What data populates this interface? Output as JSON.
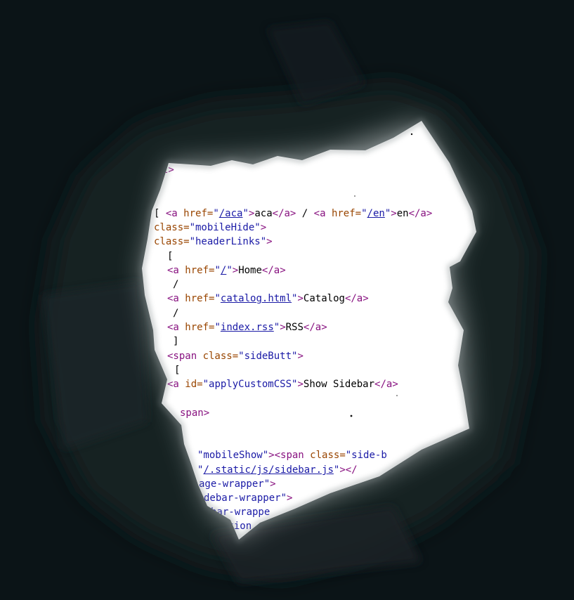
{
  "source_view": {
    "lines": [
      {
        "parts": [
          {
            "t": "l>",
            "c": "tag"
          }
        ]
      },
      {
        "parts": [
          {
            "t": "[ ",
            "c": "txt"
          },
          {
            "t": "<a ",
            "c": "tag"
          },
          {
            "t": "href=",
            "c": "attr"
          },
          {
            "t": "\"",
            "c": "val"
          },
          {
            "t": "/aca",
            "c": "link"
          },
          {
            "t": "\"",
            "c": "val"
          },
          {
            "t": ">",
            "c": "tag"
          },
          {
            "t": "aca",
            "c": "txt"
          },
          {
            "t": "</a>",
            "c": "tag"
          },
          {
            "t": " / ",
            "c": "txt"
          },
          {
            "t": "<a ",
            "c": "tag"
          },
          {
            "t": "href=",
            "c": "attr"
          },
          {
            "t": "\"",
            "c": "val"
          },
          {
            "t": "/en",
            "c": "link"
          },
          {
            "t": "\"",
            "c": "val"
          },
          {
            "t": ">",
            "c": "tag"
          },
          {
            "t": "en",
            "c": "txt"
          },
          {
            "t": "</a>",
            "c": "tag"
          }
        ]
      },
      {
        "parts": [
          {
            "t": "class=",
            "c": "attr"
          },
          {
            "t": "\"mobileHide\"",
            "c": "val"
          },
          {
            "t": ">",
            "c": "tag"
          }
        ]
      },
      {
        "parts": [
          {
            "t": "class=",
            "c": "attr"
          },
          {
            "t": "\"headerLinks\"",
            "c": "val"
          },
          {
            "t": ">",
            "c": "tag"
          }
        ]
      },
      {
        "parts": [
          {
            "t": "[",
            "c": "txt"
          }
        ]
      },
      {
        "parts": [
          {
            "t": "<a ",
            "c": "tag"
          },
          {
            "t": "href=",
            "c": "attr"
          },
          {
            "t": "\"",
            "c": "val"
          },
          {
            "t": "/",
            "c": "link"
          },
          {
            "t": "\"",
            "c": "val"
          },
          {
            "t": ">",
            "c": "tag"
          },
          {
            "t": "Home",
            "c": "txt"
          },
          {
            "t": "</a>",
            "c": "tag"
          }
        ]
      },
      {
        "parts": [
          {
            "t": "/",
            "c": "txt"
          }
        ]
      },
      {
        "parts": [
          {
            "t": "<a ",
            "c": "tag"
          },
          {
            "t": "href=",
            "c": "attr"
          },
          {
            "t": "\"",
            "c": "val"
          },
          {
            "t": "catalog.html",
            "c": "link"
          },
          {
            "t": "\"",
            "c": "val"
          },
          {
            "t": ">",
            "c": "tag"
          },
          {
            "t": "Catalog",
            "c": "txt"
          },
          {
            "t": "</a>",
            "c": "tag"
          }
        ]
      },
      {
        "parts": [
          {
            "t": "/",
            "c": "txt"
          }
        ]
      },
      {
        "parts": [
          {
            "t": "<a ",
            "c": "tag"
          },
          {
            "t": "href=",
            "c": "attr"
          },
          {
            "t": "\"",
            "c": "val"
          },
          {
            "t": "index.rss",
            "c": "link"
          },
          {
            "t": "\"",
            "c": "val"
          },
          {
            "t": ">",
            "c": "tag"
          },
          {
            "t": "RSS",
            "c": "txt"
          },
          {
            "t": "</a>",
            "c": "tag"
          }
        ]
      },
      {
        "parts": [
          {
            "t": "]",
            "c": "txt"
          }
        ]
      },
      {
        "parts": [
          {
            "t": "<span ",
            "c": "tag"
          },
          {
            "t": "class=",
            "c": "attr"
          },
          {
            "t": "\"sideButt\"",
            "c": "val"
          },
          {
            "t": ">",
            "c": "tag"
          }
        ]
      },
      {
        "parts": [
          {
            "t": "[",
            "c": "txt"
          }
        ]
      },
      {
        "parts": [
          {
            "t": "<a ",
            "c": "tag"
          },
          {
            "t": "id=",
            "c": "attr"
          },
          {
            "t": "\"applyCustomCSS\"",
            "c": "val"
          },
          {
            "t": ">",
            "c": "tag"
          },
          {
            "t": "Show Sidebar",
            "c": "txt"
          },
          {
            "t": "</a>",
            "c": "tag"
          }
        ]
      },
      {
        "parts": [
          {
            "t": "span>",
            "c": "tag"
          }
        ]
      },
      {
        "parts": [
          {
            "t": "\"mobileShow\"",
            "c": "val"
          },
          {
            "t": "><span ",
            "c": "tag"
          },
          {
            "t": "class=",
            "c": "attr"
          },
          {
            "t": "\"side-b",
            "c": "val"
          }
        ]
      },
      {
        "parts": [
          {
            "t": "\"",
            "c": "val"
          },
          {
            "t": "/.static/js/sidebar.js",
            "c": "link"
          },
          {
            "t": "\"",
            "c": "val"
          },
          {
            "t": "></",
            "c": "tag"
          }
        ]
      },
      {
        "parts": [
          {
            "t": "age-wrapper\"",
            "c": "val"
          },
          {
            "t": ">",
            "c": "tag"
          }
        ]
      },
      {
        "parts": [
          {
            "t": "debar-wrapper\"",
            "c": "val"
          },
          {
            "t": ">",
            "c": "tag"
          }
        ]
      },
      {
        "parts": [
          {
            "t": "bar-wrappe",
            "c": "val"
          }
        ]
      },
      {
        "parts": [
          {
            "t": "ation",
            "c": "val"
          }
        ]
      }
    ]
  },
  "colors": {
    "background": "#0b1417",
    "tag": "#881280",
    "attribute": "#994500",
    "value": "#1a1aa6",
    "text": "#000000"
  }
}
